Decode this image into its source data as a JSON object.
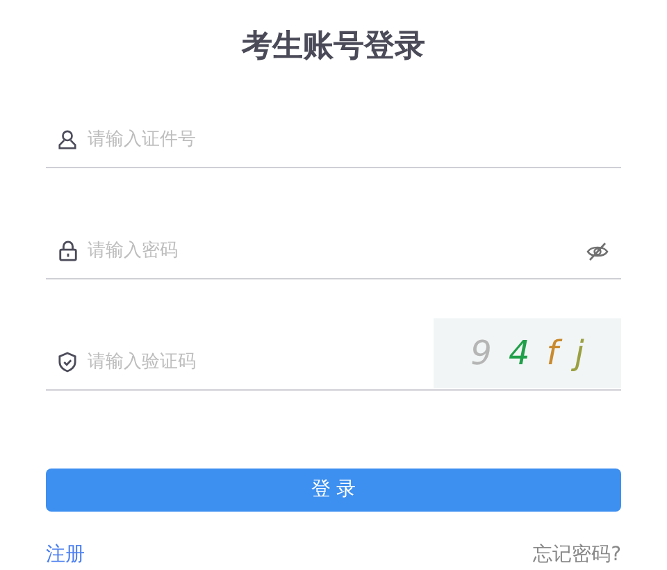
{
  "title": "考生账号登录",
  "fields": [
    {
      "kind": "user",
      "placeholder": "请输入证件号"
    },
    {
      "kind": "password",
      "placeholder": "请输入密码"
    },
    {
      "kind": "captcha",
      "placeholder": "请输入验证码",
      "captcha": [
        {
          "char": "9",
          "color": "#b5b5b5"
        },
        {
          "char": "4",
          "color": "#20a04a"
        },
        {
          "char": "f",
          "color": "#c98a2e"
        },
        {
          "char": "j",
          "color": "#9aa040"
        }
      ]
    }
  ],
  "submit": "登 录",
  "register_link": "注册",
  "forgot_link": "忘记密码?"
}
